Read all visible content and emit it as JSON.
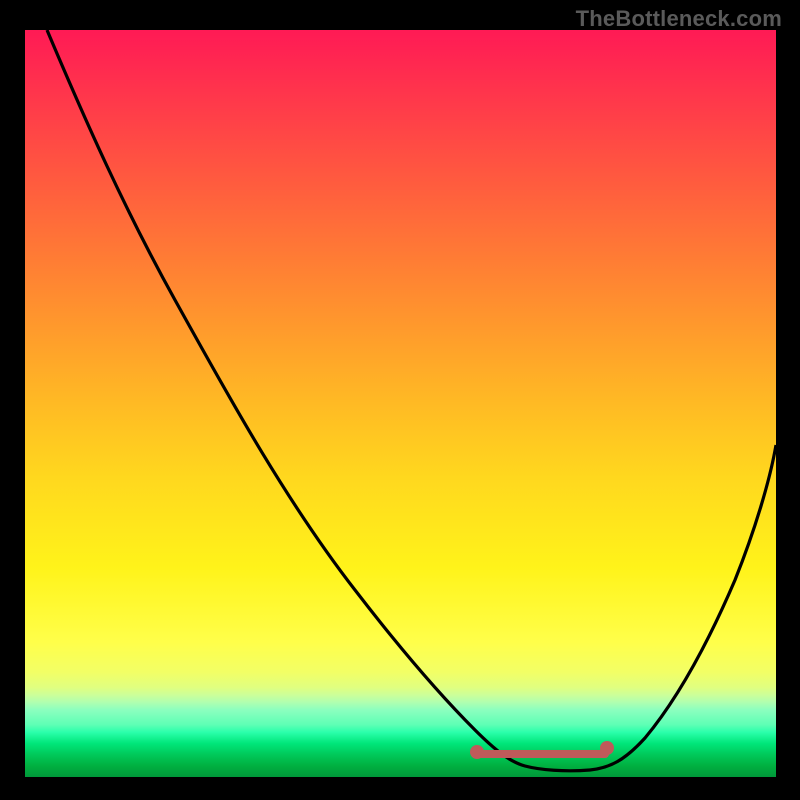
{
  "watermark": "TheBottleneck.com",
  "chart_data": {
    "type": "line",
    "title": "",
    "xlabel": "",
    "ylabel": "",
    "xlim": [
      0,
      100
    ],
    "ylim": [
      0,
      100
    ],
    "series": [
      {
        "name": "curve",
        "x": [
          3,
          10,
          20,
          30,
          40,
          50,
          57,
          60,
          63,
          66,
          70,
          74,
          78,
          84,
          90,
          96,
          100
        ],
        "y": [
          100,
          88,
          72,
          56,
          40,
          24,
          13,
          8.5,
          5,
          2.8,
          1.5,
          1.3,
          1.5,
          4,
          14,
          30,
          45
        ]
      }
    ],
    "flat_region": {
      "x_start": 60,
      "x_end": 78,
      "y": 3.0
    },
    "flat_endpoints": [
      {
        "x": 60,
        "y": 3.0
      },
      {
        "x": 78,
        "y": 3.0
      }
    ],
    "background_gradient": {
      "top": "#ff1a55",
      "mid": "#ffd81e",
      "bottom": "#00983a"
    }
  }
}
